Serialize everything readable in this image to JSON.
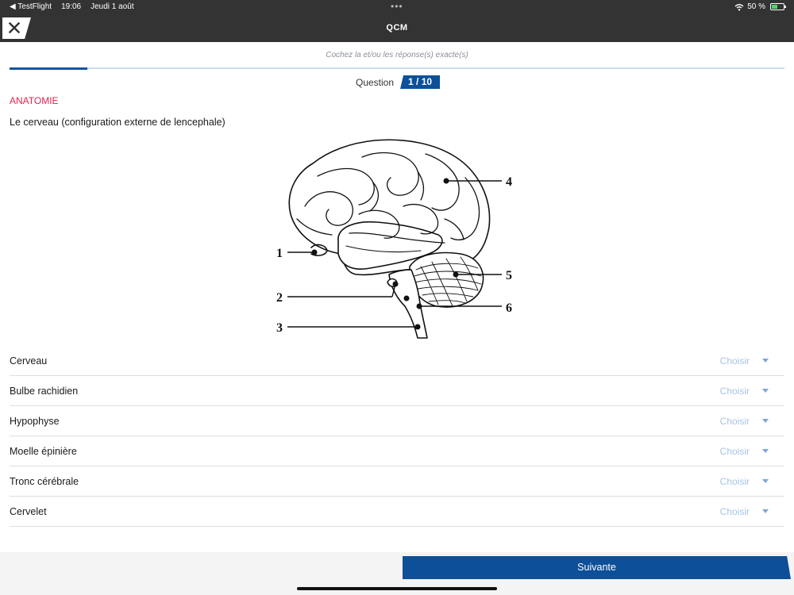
{
  "status_bar": {
    "back_app": "◀ TestFlight",
    "time": "19:06",
    "date": "Jeudi 1 août",
    "dots": "•••",
    "wifi_icon": "wifi-icon",
    "battery": "50 %",
    "battery_level": 0.5
  },
  "nav": {
    "title": "QCM",
    "close_icon": "close-icon"
  },
  "instruction": "Cochez la et/ou les réponse(s) exacte(s)",
  "progress": {
    "current": 1,
    "total": 10,
    "fraction": 0.1
  },
  "question": {
    "label": "Question",
    "number": "1 / 10",
    "category": "ANATOMIE",
    "text": "Le cerveau (configuration externe de lencephale)"
  },
  "diagram": {
    "labels": [
      "1",
      "2",
      "3",
      "4",
      "5",
      "6"
    ]
  },
  "answers": [
    {
      "label": "Cerveau",
      "value": "Choisir"
    },
    {
      "label": "Bulbe rachidien",
      "value": "Choisir"
    },
    {
      "label": "Hypophyse",
      "value": "Choisir"
    },
    {
      "label": "Moelle épinière",
      "value": "Choisir"
    },
    {
      "label": "Tronc cérébrale",
      "value": "Choisir"
    },
    {
      "label": "Cervelet",
      "value": "Choisir"
    }
  ],
  "footer": {
    "next_label": "Suivante"
  },
  "colors": {
    "brand_blue": "#0d4f98",
    "category_red": "#e0234e",
    "bar_dark": "#333333",
    "placeholder_blue": "#a8c3e3"
  }
}
